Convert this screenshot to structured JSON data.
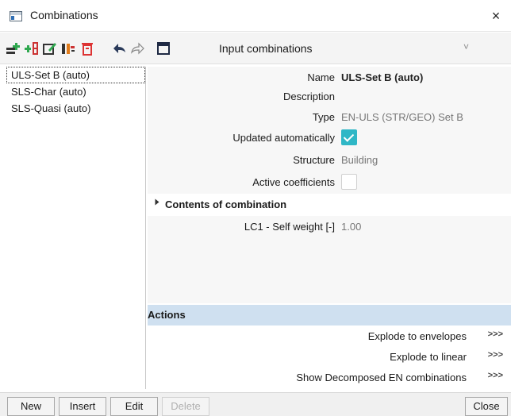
{
  "window": {
    "title": "Combinations",
    "close_glyph": "×"
  },
  "toolbar": {
    "icons": [
      "new-combination-icon",
      "insert-combination-icon",
      "edit-icon",
      "copy-icon",
      "delete-icon",
      "undo-icon",
      "redo-icon",
      "table-view-icon"
    ],
    "combo_label": "Input combinations",
    "combo_chevron": "˅"
  },
  "list": {
    "items": [
      {
        "label": "ULS-Set B (auto)",
        "selected": true
      },
      {
        "label": "SLS-Char (auto)",
        "selected": false
      },
      {
        "label": "SLS-Quasi (auto)",
        "selected": false
      }
    ]
  },
  "properties": {
    "name_label": "Name",
    "name_value": "ULS-Set B (auto)",
    "description_label": "Description",
    "description_value": "",
    "type_label": "Type",
    "type_value": "EN-ULS (STR/GEO) Set B",
    "updated_label": "Updated automatically",
    "updated_checked": true,
    "structure_label": "Structure",
    "structure_value": "Building",
    "active_label": "Active coefficients",
    "active_checked": false
  },
  "contents": {
    "title": "Contents of combination",
    "lc_label": "LC1 - Self weight [-]",
    "lc_value": "1.00"
  },
  "actions": {
    "title": "Actions",
    "items": [
      {
        "label": "Explode to envelopes",
        "go": ">>>"
      },
      {
        "label": "Explode to linear",
        "go": ">>>"
      },
      {
        "label": "Show Decomposed EN combinations",
        "go": ">>>"
      }
    ]
  },
  "buttons": {
    "new": "New",
    "insert": "Insert",
    "edit": "Edit",
    "delete": "Delete",
    "close": "Close"
  },
  "colors": {
    "accent_checkbox": "#2fb7c6",
    "actions_header": "#cfe0f0",
    "toolbar_bg": "#f4f4f4"
  }
}
